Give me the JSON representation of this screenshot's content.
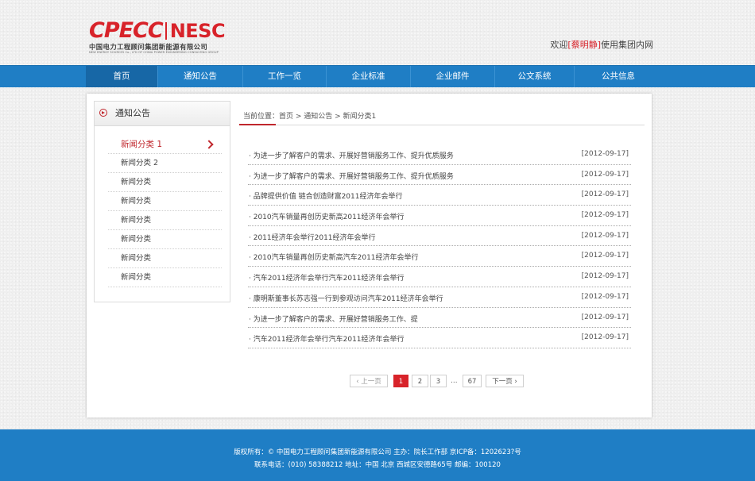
{
  "header": {
    "logo": {
      "brand_left": "CPECC",
      "brand_right": "NESC",
      "subtitle_cn": "中国电力工程顾问集团新能源有限公司",
      "subtitle_en": "NEW ENERGY SOURCES Co., LTD OF CHINA POWER ENGINEERING CONSULTING GROUP"
    },
    "welcome_prefix": "欢迎",
    "welcome_user": "[蔡明静]",
    "welcome_suffix": "使用集团内网"
  },
  "nav": {
    "items": [
      "首页",
      "通知公告",
      "工作一览",
      "企业标准",
      "企业邮件",
      "公文系统",
      "公共信息"
    ],
    "active": "首页"
  },
  "sidebar": {
    "title": "通知公告",
    "items": [
      "新闻分类 1",
      "新闻分类 2",
      "新闻分类",
      "新闻分类",
      "新闻分类",
      "新闻分类",
      "新闻分类",
      "新闻分类"
    ]
  },
  "breadcrumb": "当前位置：首页 > 通知公告 > 新闻分类1",
  "news": [
    {
      "title": "· 为进一步了解客户的需求、开展好营销服务工作、提升优质服务",
      "date": "[2012-09-17]"
    },
    {
      "title": "· 为进一步了解客户的需求、开展好营销服务工作、提升优质服务",
      "date": "[2012-09-17]"
    },
    {
      "title": "· 品牌提供价值 链合创造财富2011经济年会举行",
      "date": "[2012-09-17]"
    },
    {
      "title": "· 2010汽车销量再创历史新高2011经济年会举行",
      "date": "[2012-09-17]"
    },
    {
      "title": "· 2011经济年会举行2011经济年会举行",
      "date": "[2012-09-17]"
    },
    {
      "title": "· 2010汽车销量再创历史新高汽车2011经济年会举行",
      "date": "[2012-09-17]"
    },
    {
      "title": "· 汽车2011经济年会举行汽车2011经济年会举行",
      "date": "[2012-09-17]"
    },
    {
      "title": "· 康明斯董事长苏志强一行到参观访问汽车2011经济年会举行",
      "date": "[2012-09-17]"
    },
    {
      "title": "· 为进一步了解客户的需求、开展好营销服务工作、提",
      "date": "[2012-09-17]"
    },
    {
      "title": "· 汽车2011经济年会举行汽车2011经济年会举行",
      "date": "[2012-09-17]"
    }
  ],
  "pagination": {
    "prev": "上一页",
    "pages": [
      "1",
      "2",
      "3"
    ],
    "ellipsis": "...",
    "last": "67",
    "next": "下一页",
    "current": "1"
  },
  "footer": {
    "line1": "版权所有：© 中国电力工程顾问集团新能源有限公司  主办：院长工作部  京ICP备：1202623?号",
    "line2": "联系电话：(010) 58388212    地址：中国  北京  西城区安德路65号  邮编：100120"
  },
  "colors": {
    "brand_red": "#d8232a",
    "nav_blue": "#1f7ec5",
    "nav_active": "#1767a6"
  }
}
